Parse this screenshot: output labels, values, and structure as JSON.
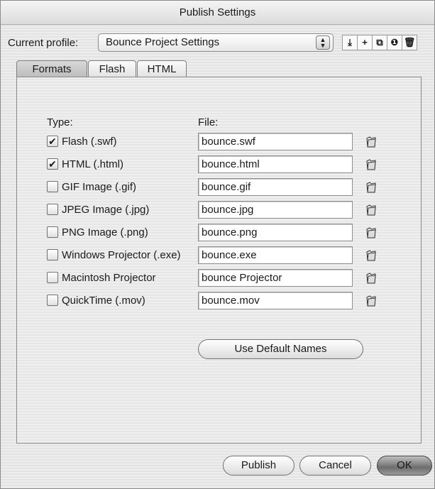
{
  "window": {
    "title": "Publish Settings"
  },
  "profile": {
    "label": "Current profile:",
    "selected": "Bounce Project Settings",
    "icons": [
      "import-export-icon",
      "add-icon",
      "duplicate-icon",
      "info-icon",
      "trash-icon"
    ]
  },
  "tabs": [
    {
      "label": "Formats",
      "active": true
    },
    {
      "label": "Flash",
      "active": false
    },
    {
      "label": "HTML",
      "active": false
    }
  ],
  "formats": {
    "type_header": "Type:",
    "file_header": "File:",
    "rows": [
      {
        "label": "Flash  (.swf)",
        "checked": true,
        "file": "bounce.swf"
      },
      {
        "label": "HTML (.html)",
        "checked": true,
        "file": "bounce.html"
      },
      {
        "label": "GIF Image (.gif)",
        "checked": false,
        "file": "bounce.gif"
      },
      {
        "label": "JPEG Image (.jpg)",
        "checked": false,
        "file": "bounce.jpg"
      },
      {
        "label": "PNG Image (.png)",
        "checked": false,
        "file": "bounce.png"
      },
      {
        "label": "Windows Projector (.exe)",
        "checked": false,
        "file": "bounce.exe"
      },
      {
        "label": "Macintosh Projector",
        "checked": false,
        "file": "bounce Projector"
      },
      {
        "label": "QuickTime (.mov)",
        "checked": false,
        "file": "bounce.mov"
      }
    ],
    "default_names_label": "Use Default Names"
  },
  "buttons": {
    "publish": "Publish",
    "cancel": "Cancel",
    "ok": "OK"
  }
}
